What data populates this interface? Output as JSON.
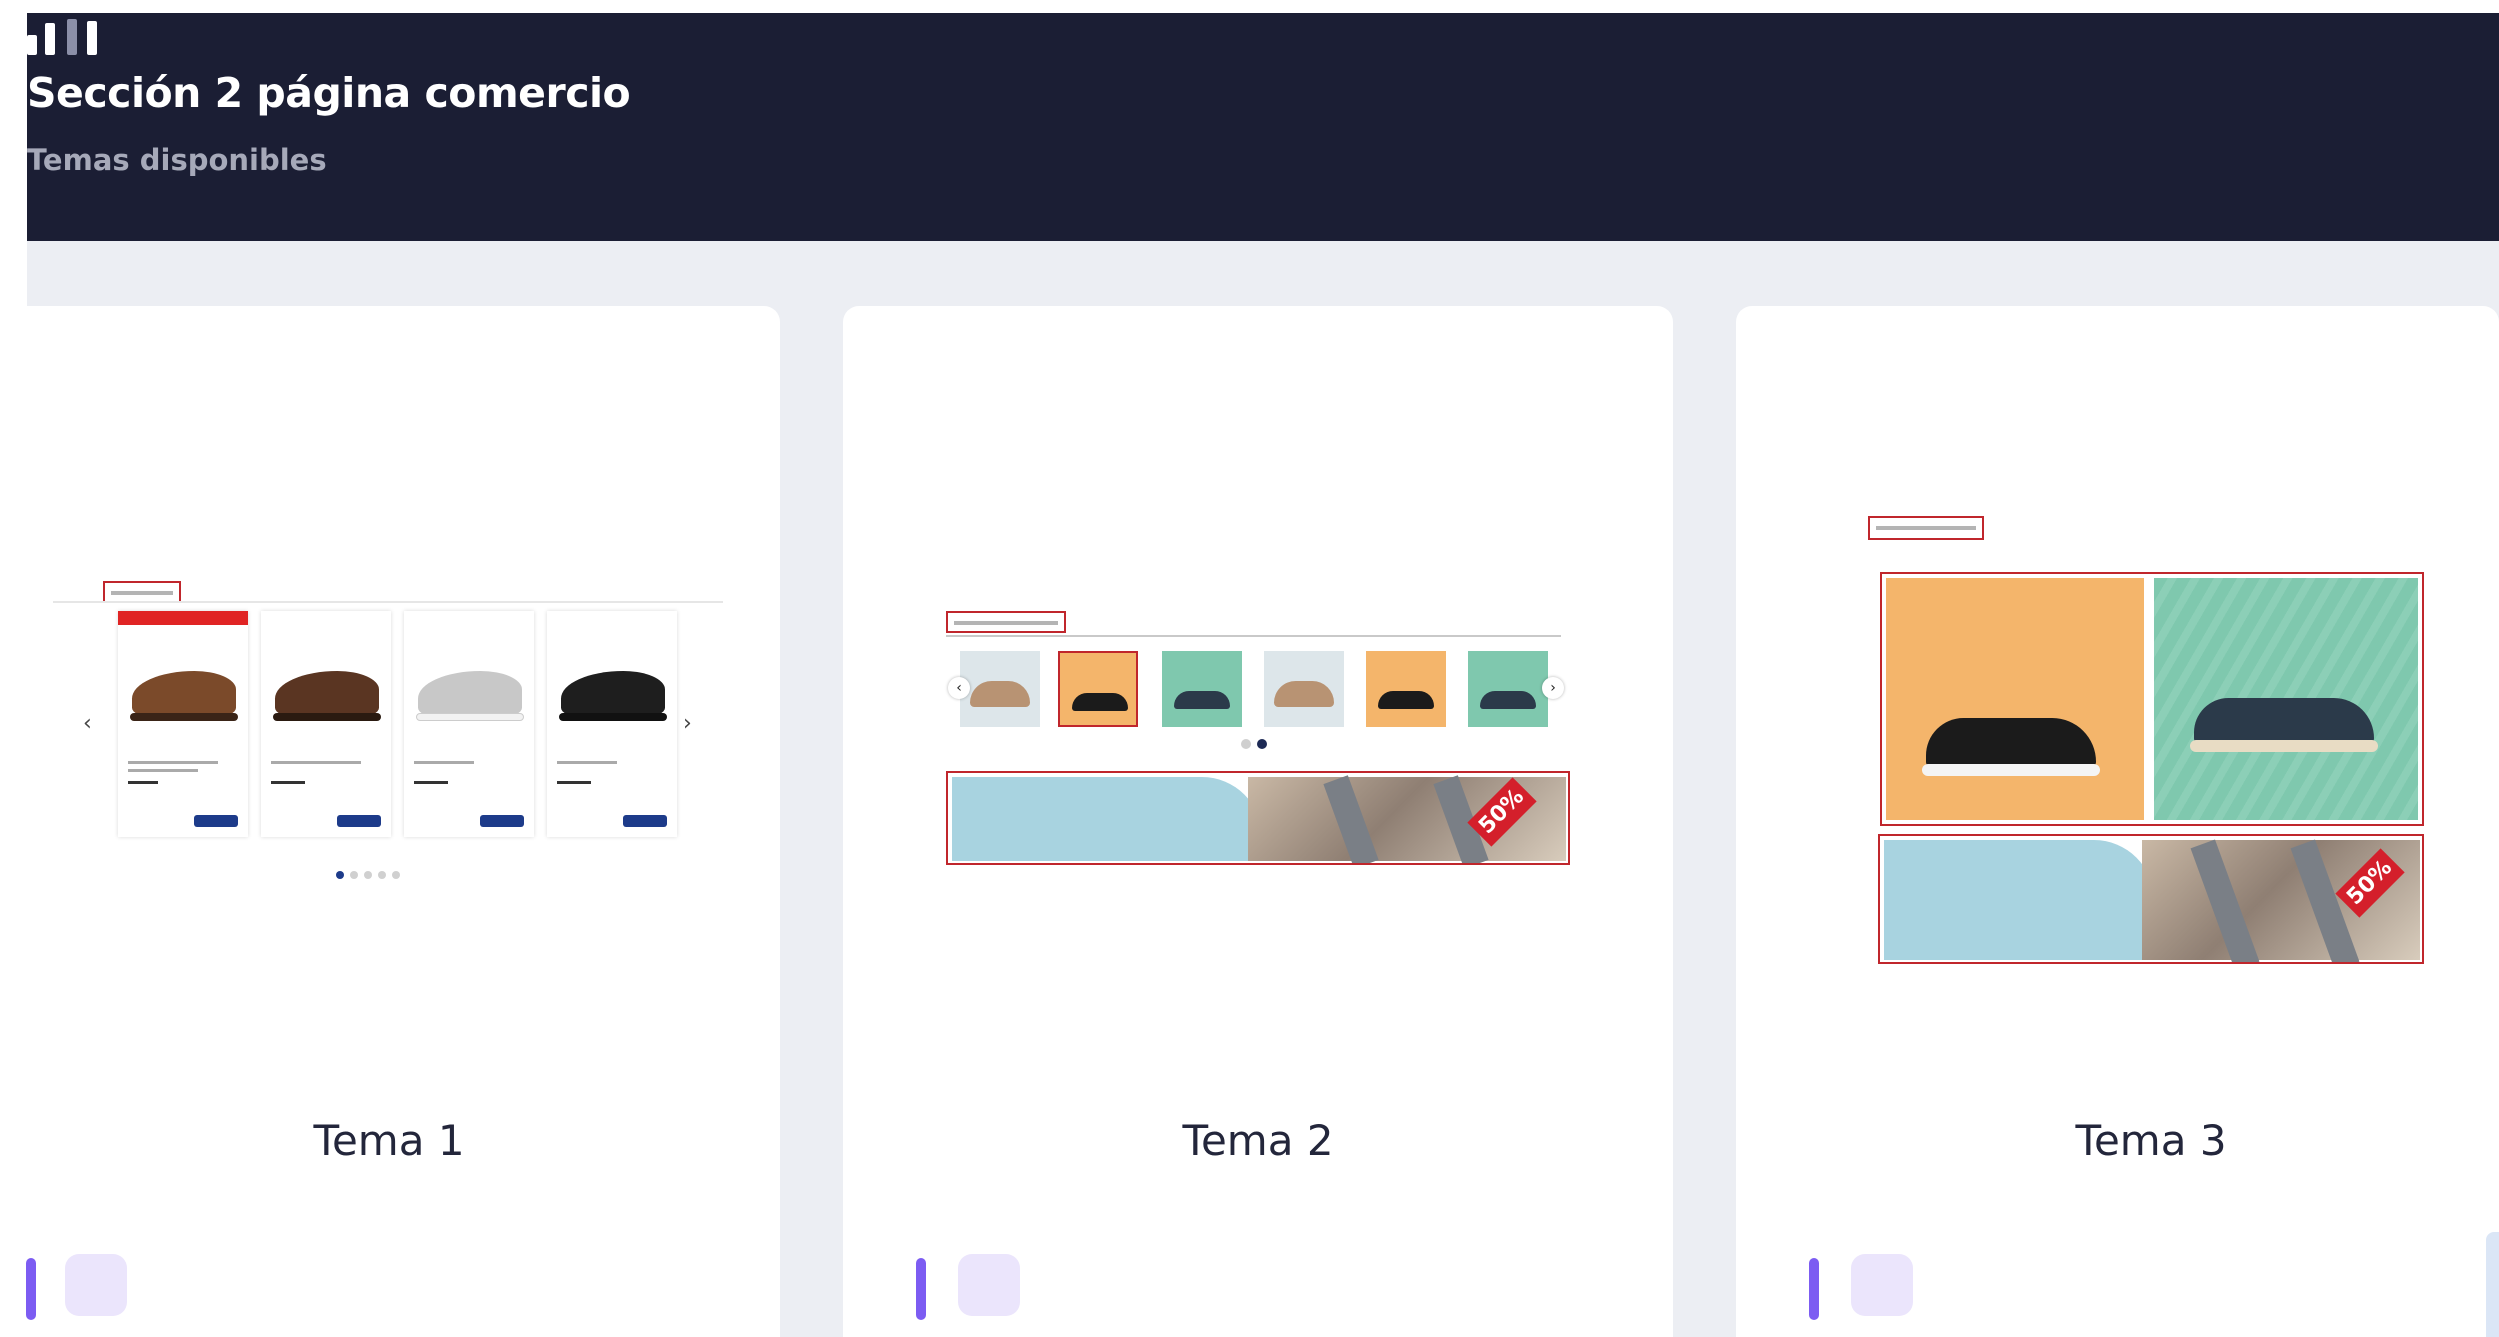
{
  "header": {
    "title": "Sección 2 página comercio",
    "subtitle": "Temas disponibles"
  },
  "themes": [
    {
      "label": "Tema 1"
    },
    {
      "label": "Tema 2"
    },
    {
      "label": "Tema 3"
    }
  ],
  "preview": {
    "sale_tag": "50%"
  },
  "colors": {
    "header_bg": "#1b1e34",
    "content_bg": "#eceef3",
    "accent": "#7c5cf2",
    "checkbox_bg": "#ebe5fc",
    "preview_highlight": "#c0262c"
  },
  "icons": {
    "logo": "bars-logo-icon",
    "carousel_prev": "chevron-left-icon",
    "carousel_next": "chevron-right-icon"
  }
}
